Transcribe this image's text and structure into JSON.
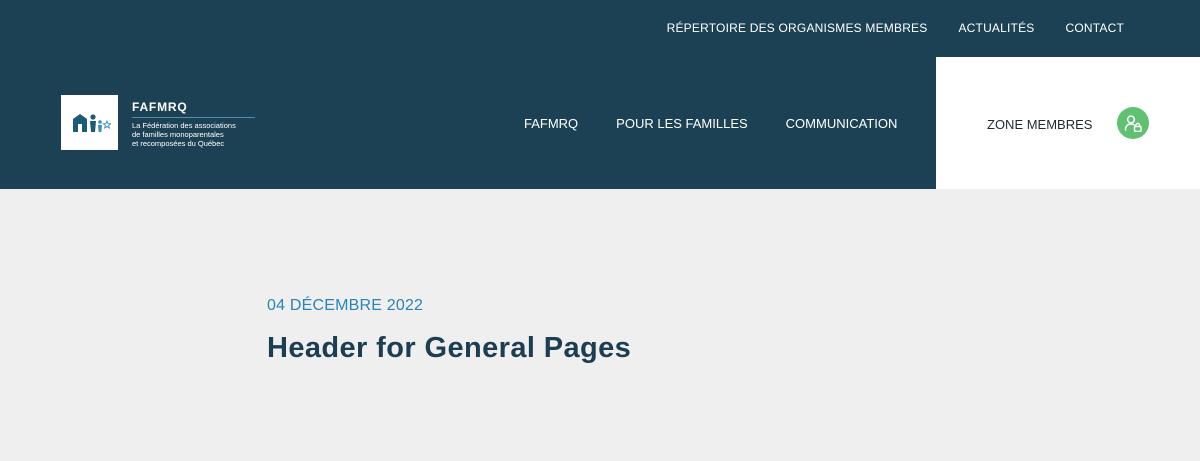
{
  "top_nav": {
    "items": [
      {
        "label": "RÉPERTOIRE DES ORGANISMES MEMBRES"
      },
      {
        "label": "ACTUALITÉS"
      },
      {
        "label": "CONTACT"
      }
    ]
  },
  "logo": {
    "name": "FAFMRQ",
    "tagline_line1": "La Fédération des associations",
    "tagline_line2": "de familles monoparentales",
    "tagline_line3": "et recomposées du Québec"
  },
  "main_nav": {
    "items": [
      {
        "label": "FAFMRQ"
      },
      {
        "label": "POUR LES FAMILLES"
      },
      {
        "label": "COMMUNICATION"
      }
    ]
  },
  "members_zone": {
    "label": "ZONE MEMBRES",
    "icon": "user-lock-icon",
    "accent_color": "#62c072"
  },
  "article": {
    "date": "04 DÉCEMBRE 2022",
    "title": "Header for General Pages"
  },
  "colors": {
    "header_bg": "#1c4155",
    "page_bg": "#efefef",
    "date_color": "#2a84b6",
    "title_color": "#1d3d52"
  }
}
